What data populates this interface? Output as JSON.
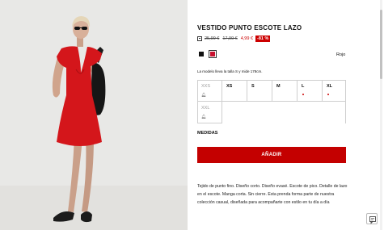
{
  "product": {
    "title": "VESTIDO PUNTO ESCOTE LAZO",
    "price_old_1": "25,99 €",
    "price_old_2": "17,99 €",
    "price_new": "4,99 €",
    "discount": "-81 %",
    "color_name": "Rojo",
    "model_note": "La modelo lleva la talla S y mide 178cm.",
    "measures_label": "MEDIDAS",
    "add_button": "AÑADIR",
    "description": "Tejido de punto fino. Diseño corto. Diseño evasé. Escote de pico. Detalle de lazo en el escote. Manga corta. Sin cierre. Esta prenda forma parte de nuestra colección casual, diseñada para acompañarte con estilo en tu día a día"
  },
  "swatches": [
    {
      "name": "black",
      "color": "#111111"
    },
    {
      "name": "red",
      "color": "#c8102e"
    }
  ],
  "sizes": [
    {
      "label": "XXS",
      "available": false,
      "notify_icon": "bell-icon"
    },
    {
      "label": "XS",
      "available": true
    },
    {
      "label": "S",
      "available": true
    },
    {
      "label": "M",
      "available": true
    },
    {
      "label": "L",
      "available": true,
      "low_stock": true
    },
    {
      "label": "XL",
      "available": true,
      "low_stock": true
    },
    {
      "label": "XXL",
      "available": false,
      "notify_icon": "bell-icon"
    }
  ],
  "colors": {
    "accent": "#c40000",
    "discount_bg": "#cc0000"
  }
}
